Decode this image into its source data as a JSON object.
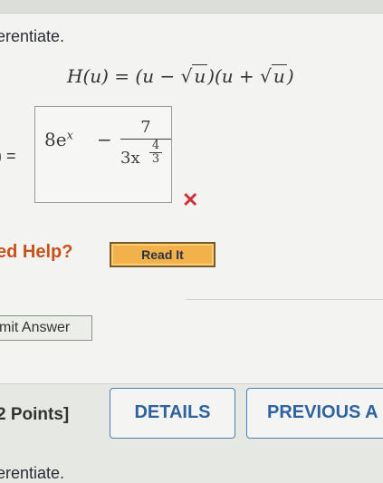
{
  "question": {
    "instruction": "erentiate.",
    "equation": {
      "lhs": "H(u) = (u − ",
      "sqrt1": "u",
      "mid": ")(u + ",
      "sqrt2": "u",
      "end": ")"
    },
    "answer_label": ") =",
    "answer": {
      "term1": "8e",
      "term1_exp": "x",
      "minus": "−",
      "numerator": "7",
      "denominator": "3x",
      "exp_num": "4",
      "exp_den": "3"
    },
    "result_mark": "✕"
  },
  "help": {
    "label": "ed Help?",
    "read_it": "Read It"
  },
  "submit_label": "mit Answer",
  "footer": {
    "points": "2 Points]",
    "details_label": "DETAILS",
    "previous_label": "PREVIOUS A",
    "next_instruction": "erentiate."
  },
  "colors": {
    "error_mark": "#d0303a",
    "help_text": "#c8501a",
    "read_it_bg": "#f2b14a",
    "button_border": "#4a7fb5",
    "button_text": "#2f63a0"
  }
}
